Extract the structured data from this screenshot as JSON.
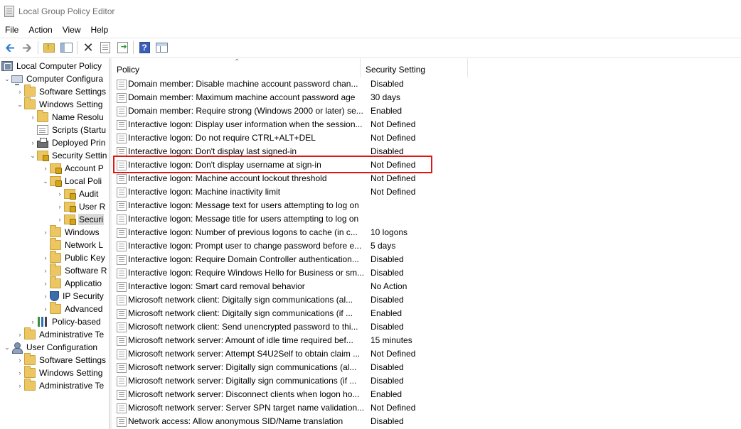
{
  "window": {
    "title": "Local Group Policy Editor"
  },
  "menu": [
    "File",
    "Action",
    "View",
    "Help"
  ],
  "toolbar": {
    "icons": [
      "back-arrow-icon",
      "forward-arrow-icon",
      "up-folder-icon",
      "show-hide-tree-icon",
      "delete-icon",
      "properties-icon",
      "export-list-icon",
      "help-icon",
      "action-pane-icon"
    ]
  },
  "tree": [
    {
      "label": "Local Computer Policy",
      "icon": "policy-icon"
    },
    {
      "label": "Computer Configura",
      "icon": "computer-icon"
    },
    {
      "label": "Software Settings",
      "icon": "folder-icon"
    },
    {
      "label": "Windows Setting",
      "icon": "folder-icon"
    },
    {
      "label": "Name Resolu",
      "icon": "folder-icon"
    },
    {
      "label": "Scripts (Startu",
      "icon": "document-icon"
    },
    {
      "label": "Deployed Prin",
      "icon": "printer-icon"
    },
    {
      "label": "Security Settin",
      "icon": "security-settings-icon"
    },
    {
      "label": "Account P",
      "icon": "folder-lock-icon"
    },
    {
      "label": "Local Poli",
      "icon": "folder-lock-icon"
    },
    {
      "label": "Audit",
      "icon": "folder-lock-icon"
    },
    {
      "label": "User R",
      "icon": "folder-lock-icon"
    },
    {
      "label": "Securi",
      "icon": "folder-lock-icon"
    },
    {
      "label": "Windows",
      "icon": "folder-icon"
    },
    {
      "label": "Network L",
      "icon": "folder-icon"
    },
    {
      "label": "Public Key",
      "icon": "folder-icon"
    },
    {
      "label": "Software R",
      "icon": "folder-icon"
    },
    {
      "label": "Applicatio",
      "icon": "folder-icon"
    },
    {
      "label": "IP Security",
      "icon": "shield-icon"
    },
    {
      "label": "Advanced",
      "icon": "folder-icon"
    },
    {
      "label": "Policy-based",
      "icon": "chart-icon"
    },
    {
      "label": "Administrative Te",
      "icon": "folder-icon"
    },
    {
      "label": "User Configuration",
      "icon": "user-icon"
    },
    {
      "label": "Software Settings",
      "icon": "folder-icon"
    },
    {
      "label": "Windows Setting",
      "icon": "folder-icon"
    },
    {
      "label": "Administrative Te",
      "icon": "folder-icon"
    }
  ],
  "list": {
    "columns": [
      "Policy",
      "Security Setting"
    ],
    "highlighted_row": "Interactive logon: Don't display username at sign-in",
    "highlight_color": "#e01515",
    "rows": [
      {
        "policy": "Domain member: Disable machine account password chan...",
        "setting": "Disabled"
      },
      {
        "policy": "Domain member: Maximum machine account password age",
        "setting": "30 days"
      },
      {
        "policy": "Domain member: Require strong (Windows 2000 or later) se...",
        "setting": "Enabled"
      },
      {
        "policy": "Interactive logon: Display user information when the session...",
        "setting": "Not Defined"
      },
      {
        "policy": "Interactive logon: Do not require CTRL+ALT+DEL",
        "setting": "Not Defined"
      },
      {
        "policy": "Interactive logon: Don't display last signed-in",
        "setting": "Disabled"
      },
      {
        "policy": "Interactive logon: Don't display username at sign-in",
        "setting": "Not Defined"
      },
      {
        "policy": "Interactive logon: Machine account lockout threshold",
        "setting": "Not Defined"
      },
      {
        "policy": "Interactive logon: Machine inactivity limit",
        "setting": "Not Defined"
      },
      {
        "policy": "Interactive logon: Message text for users attempting to log on",
        "setting": ""
      },
      {
        "policy": "Interactive logon: Message title for users attempting to log on",
        "setting": ""
      },
      {
        "policy": "Interactive logon: Number of previous logons to cache (in c...",
        "setting": "10 logons"
      },
      {
        "policy": "Interactive logon: Prompt user to change password before e...",
        "setting": "5 days"
      },
      {
        "policy": "Interactive logon: Require Domain Controller authentication...",
        "setting": "Disabled"
      },
      {
        "policy": "Interactive logon: Require Windows Hello for Business or sm...",
        "setting": "Disabled"
      },
      {
        "policy": "Interactive logon: Smart card removal behavior",
        "setting": "No Action"
      },
      {
        "policy": "Microsoft network client: Digitally sign communications (al...",
        "setting": "Disabled"
      },
      {
        "policy": "Microsoft network client: Digitally sign communications (if ...",
        "setting": "Enabled"
      },
      {
        "policy": "Microsoft network client: Send unencrypted password to thi...",
        "setting": "Disabled"
      },
      {
        "policy": "Microsoft network server: Amount of idle time required bef...",
        "setting": "15 minutes"
      },
      {
        "policy": "Microsoft network server: Attempt S4U2Self to obtain claim ...",
        "setting": "Not Defined"
      },
      {
        "policy": "Microsoft network server: Digitally sign communications (al...",
        "setting": "Disabled"
      },
      {
        "policy": "Microsoft network server: Digitally sign communications (if ...",
        "setting": "Disabled"
      },
      {
        "policy": "Microsoft network server: Disconnect clients when logon ho...",
        "setting": "Enabled"
      },
      {
        "policy": "Microsoft network server: Server SPN target name validation...",
        "setting": "Not Defined"
      },
      {
        "policy": "Network access: Allow anonymous SID/Name translation",
        "setting": "Disabled"
      }
    ]
  }
}
